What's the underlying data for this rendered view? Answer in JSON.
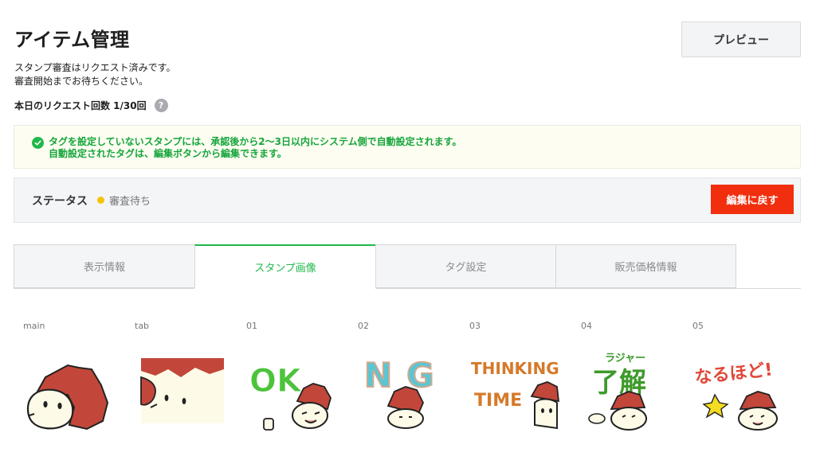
{
  "header": {
    "title": "アイテム管理",
    "preview_label": "プレビュー"
  },
  "status_message": {
    "line1": "スタンプ審査はリクエスト済みです。",
    "line2": "審査開始までお待ちください。"
  },
  "request_count": {
    "label": "本日のリクエスト回数 1/30回",
    "help_icon_glyph": "?"
  },
  "notice": {
    "icon": "check-circle-icon",
    "line1": "タグを設定していないスタンプには、承認後から2～3日以内にシステム側で自動設定されます。",
    "line2": "自動設定されたタグは、編集ボタンから編集できます。"
  },
  "status_bar": {
    "label": "ステータス",
    "value": "審査待ち",
    "dot_color": "#f5c400",
    "back_button_label": "編集に戻す"
  },
  "tabs": [
    {
      "label": "表示情報",
      "active": false
    },
    {
      "label": "スタンプ画像",
      "active": true
    },
    {
      "label": "タグ設定",
      "active": false
    },
    {
      "label": "販売価格情報",
      "active": false
    }
  ],
  "stickers": [
    {
      "label": "main",
      "icon": "hedgehog-main-icon"
    },
    {
      "label": "tab",
      "icon": "hedgehog-tab-icon"
    },
    {
      "label": "01",
      "icon": "ok-sticker-icon",
      "text": "OK"
    },
    {
      "label": "02",
      "icon": "ng-sticker-icon",
      "text": "NG"
    },
    {
      "label": "03",
      "icon": "thinking-time-sticker-icon",
      "text": "THINKING TIME"
    },
    {
      "label": "04",
      "icon": "ryokai-sticker-icon",
      "text": "ラジャー 了解"
    },
    {
      "label": "05",
      "icon": "naruhodo-sticker-icon",
      "text": "なるほど!"
    }
  ],
  "colors": {
    "accent_green": "#1fb84a",
    "danger_red": "#f12f0e",
    "status_yellow": "#f5c400"
  }
}
